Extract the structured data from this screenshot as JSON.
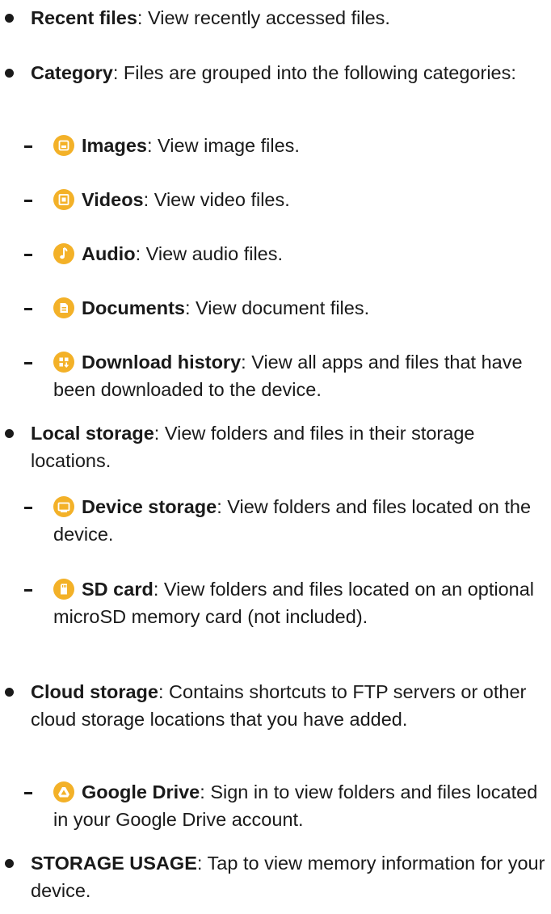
{
  "accent_color": "#f3b128",
  "items": {
    "recent": {
      "term": "Recent files",
      "desc": ": View recently accessed files."
    },
    "category": {
      "term": "Category",
      "desc": ": Files are grouped into the following categories:"
    },
    "images": {
      "icon": "image-icon",
      "term": "Images",
      "desc": ": View image files."
    },
    "videos": {
      "icon": "video-icon",
      "term": "Videos",
      "desc": ": View video files."
    },
    "audio": {
      "icon": "audio-icon",
      "term": "Audio",
      "desc": ": View audio files."
    },
    "documents": {
      "icon": "document-icon",
      "term": "Documents",
      "desc": ": View document files."
    },
    "download": {
      "icon": "download-history-icon",
      "term": "Download history",
      "desc": ": View all apps and files that have been downloaded to the device."
    },
    "local": {
      "term": "Local storage",
      "desc": ": View folders and files in their storage locations."
    },
    "device": {
      "icon": "device-storage-icon",
      "term": "Device storage",
      "desc": ": View folders and files located on the device."
    },
    "sdcard": {
      "icon": "sd-card-icon",
      "term": "SD card",
      "desc": ": View folders and files located on an optional microSD memory card (not included)."
    },
    "cloud": {
      "term": "Cloud storage",
      "desc": ": Contains shortcuts to FTP servers or other cloud storage locations that you have added."
    },
    "gdrive": {
      "icon": "google-drive-icon",
      "term": "Google Drive",
      "desc": ": Sign in to view folders and files located in your Google Drive account."
    },
    "usage": {
      "term": "STORAGE USAGE",
      "desc": ": Tap to view memory information for your device."
    }
  }
}
